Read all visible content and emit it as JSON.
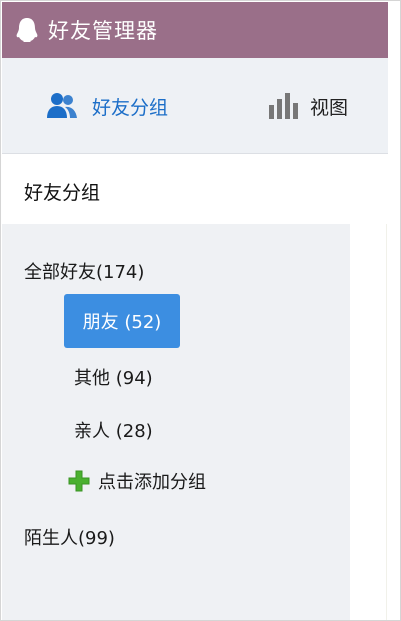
{
  "window": {
    "title": "好友管理器"
  },
  "toolbar": {
    "friends_group_label": "好友分组",
    "view_label": "视图"
  },
  "section": {
    "title": "好友分组"
  },
  "groups": {
    "all": "全部好友(174)",
    "friends": "朋友 (52)",
    "other": "其他 (94)",
    "family": "亲人 (28)",
    "add_group": "点击添加分组",
    "strangers": "陌生人(99)"
  },
  "colors": {
    "titlebar": "#9a6f89",
    "accent": "#3c8ee1",
    "toolbar_bg": "#eef1f5",
    "sidebar_bg": "#eff1f4",
    "add_icon": "#4ab030"
  },
  "icons": {
    "app": "penguin-icon",
    "friends": "users-icon",
    "view": "bar-chart-icon",
    "add": "plus-icon"
  }
}
